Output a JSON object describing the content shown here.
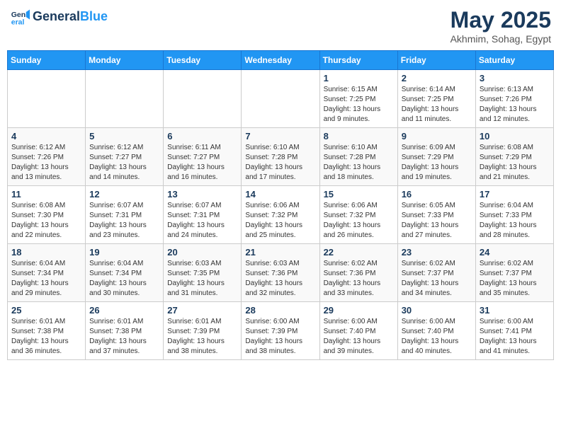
{
  "logo": {
    "line1": "General",
    "line2": "Blue"
  },
  "title": "May 2025",
  "location": "Akhmim, Sohag, Egypt",
  "weekdays": [
    "Sunday",
    "Monday",
    "Tuesday",
    "Wednesday",
    "Thursday",
    "Friday",
    "Saturday"
  ],
  "weeks": [
    [
      {
        "day": "",
        "info": ""
      },
      {
        "day": "",
        "info": ""
      },
      {
        "day": "",
        "info": ""
      },
      {
        "day": "",
        "info": ""
      },
      {
        "day": "1",
        "info": "Sunrise: 6:15 AM\nSunset: 7:25 PM\nDaylight: 13 hours\nand 9 minutes."
      },
      {
        "day": "2",
        "info": "Sunrise: 6:14 AM\nSunset: 7:25 PM\nDaylight: 13 hours\nand 11 minutes."
      },
      {
        "day": "3",
        "info": "Sunrise: 6:13 AM\nSunset: 7:26 PM\nDaylight: 13 hours\nand 12 minutes."
      }
    ],
    [
      {
        "day": "4",
        "info": "Sunrise: 6:12 AM\nSunset: 7:26 PM\nDaylight: 13 hours\nand 13 minutes."
      },
      {
        "day": "5",
        "info": "Sunrise: 6:12 AM\nSunset: 7:27 PM\nDaylight: 13 hours\nand 14 minutes."
      },
      {
        "day": "6",
        "info": "Sunrise: 6:11 AM\nSunset: 7:27 PM\nDaylight: 13 hours\nand 16 minutes."
      },
      {
        "day": "7",
        "info": "Sunrise: 6:10 AM\nSunset: 7:28 PM\nDaylight: 13 hours\nand 17 minutes."
      },
      {
        "day": "8",
        "info": "Sunrise: 6:10 AM\nSunset: 7:28 PM\nDaylight: 13 hours\nand 18 minutes."
      },
      {
        "day": "9",
        "info": "Sunrise: 6:09 AM\nSunset: 7:29 PM\nDaylight: 13 hours\nand 19 minutes."
      },
      {
        "day": "10",
        "info": "Sunrise: 6:08 AM\nSunset: 7:29 PM\nDaylight: 13 hours\nand 21 minutes."
      }
    ],
    [
      {
        "day": "11",
        "info": "Sunrise: 6:08 AM\nSunset: 7:30 PM\nDaylight: 13 hours\nand 22 minutes."
      },
      {
        "day": "12",
        "info": "Sunrise: 6:07 AM\nSunset: 7:31 PM\nDaylight: 13 hours\nand 23 minutes."
      },
      {
        "day": "13",
        "info": "Sunrise: 6:07 AM\nSunset: 7:31 PM\nDaylight: 13 hours\nand 24 minutes."
      },
      {
        "day": "14",
        "info": "Sunrise: 6:06 AM\nSunset: 7:32 PM\nDaylight: 13 hours\nand 25 minutes."
      },
      {
        "day": "15",
        "info": "Sunrise: 6:06 AM\nSunset: 7:32 PM\nDaylight: 13 hours\nand 26 minutes."
      },
      {
        "day": "16",
        "info": "Sunrise: 6:05 AM\nSunset: 7:33 PM\nDaylight: 13 hours\nand 27 minutes."
      },
      {
        "day": "17",
        "info": "Sunrise: 6:04 AM\nSunset: 7:33 PM\nDaylight: 13 hours\nand 28 minutes."
      }
    ],
    [
      {
        "day": "18",
        "info": "Sunrise: 6:04 AM\nSunset: 7:34 PM\nDaylight: 13 hours\nand 29 minutes."
      },
      {
        "day": "19",
        "info": "Sunrise: 6:04 AM\nSunset: 7:34 PM\nDaylight: 13 hours\nand 30 minutes."
      },
      {
        "day": "20",
        "info": "Sunrise: 6:03 AM\nSunset: 7:35 PM\nDaylight: 13 hours\nand 31 minutes."
      },
      {
        "day": "21",
        "info": "Sunrise: 6:03 AM\nSunset: 7:36 PM\nDaylight: 13 hours\nand 32 minutes."
      },
      {
        "day": "22",
        "info": "Sunrise: 6:02 AM\nSunset: 7:36 PM\nDaylight: 13 hours\nand 33 minutes."
      },
      {
        "day": "23",
        "info": "Sunrise: 6:02 AM\nSunset: 7:37 PM\nDaylight: 13 hours\nand 34 minutes."
      },
      {
        "day": "24",
        "info": "Sunrise: 6:02 AM\nSunset: 7:37 PM\nDaylight: 13 hours\nand 35 minutes."
      }
    ],
    [
      {
        "day": "25",
        "info": "Sunrise: 6:01 AM\nSunset: 7:38 PM\nDaylight: 13 hours\nand 36 minutes."
      },
      {
        "day": "26",
        "info": "Sunrise: 6:01 AM\nSunset: 7:38 PM\nDaylight: 13 hours\nand 37 minutes."
      },
      {
        "day": "27",
        "info": "Sunrise: 6:01 AM\nSunset: 7:39 PM\nDaylight: 13 hours\nand 38 minutes."
      },
      {
        "day": "28",
        "info": "Sunrise: 6:00 AM\nSunset: 7:39 PM\nDaylight: 13 hours\nand 38 minutes."
      },
      {
        "day": "29",
        "info": "Sunrise: 6:00 AM\nSunset: 7:40 PM\nDaylight: 13 hours\nand 39 minutes."
      },
      {
        "day": "30",
        "info": "Sunrise: 6:00 AM\nSunset: 7:40 PM\nDaylight: 13 hours\nand 40 minutes."
      },
      {
        "day": "31",
        "info": "Sunrise: 6:00 AM\nSunset: 7:41 PM\nDaylight: 13 hours\nand 41 minutes."
      }
    ]
  ]
}
